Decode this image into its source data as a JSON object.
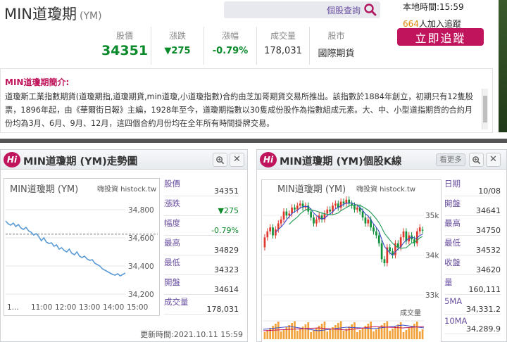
{
  "header": {
    "title": "MIN道瓊期",
    "code": "(YM)",
    "search_placeholder": "個股查詢",
    "local_time": "本地時間:15:59",
    "follow_count": "664",
    "follow_suffix": "人加入追蹤",
    "follow_button": "立即追蹤"
  },
  "quote": {
    "columns": [
      {
        "label": "股價",
        "value": "34351"
      },
      {
        "label": "漲跌",
        "value": "▼275"
      },
      {
        "label": "漲幅",
        "value": "-0.79%"
      },
      {
        "label": "成交量",
        "value": "178,031"
      },
      {
        "label": "股市",
        "value": "國際期貨"
      }
    ]
  },
  "intro": {
    "heading": "MIN道瓊期簡介:",
    "text": "道瓊斯工業指數期貨(道瓊期指,道瓊期貨,min道瓊,小道瓊指數)合約由芝加哥期貨交易所推出。該指數於1884年創立，初期只有12隻股票，1896年起，由《華爾街日報》主編，1928年至今，道瓊期指數以30隻成份股作為指數組成元素。大、中、小型道指期貨的合約月份均為3月、6月、9月、12月，這四個合約月份均在全年所有時間掛牌交易。"
  },
  "trend_panel": {
    "title": "MIN道瓊期 (YM)走勢圖",
    "chart_title": "MIN道瓊期 (YM)",
    "brand": "嗨投資 histock.tw",
    "stats": [
      {
        "label": "股價",
        "value": "34351"
      },
      {
        "label": "漲跌",
        "value": "▼275"
      },
      {
        "label": "幅度",
        "value": "-0.79%"
      },
      {
        "label": "最高",
        "value": "34829"
      },
      {
        "label": "最低",
        "value": "34323"
      },
      {
        "label": "開盤",
        "value": "34614"
      },
      {
        "label": "成交量",
        "value": "178,031"
      }
    ],
    "update_time": "更新時間:2021.10.11 15:59"
  },
  "kline_panel": {
    "title": "MIN道瓊期 (YM)個股K線",
    "more_button": "看更多",
    "chart_title": "MIN道瓊期 (YM)",
    "brand": "嗨投資 histock.tw",
    "volume_label": "成交量",
    "stats": [
      {
        "label": "日期",
        "value": "10/08"
      },
      {
        "label": "開盤",
        "value": "34641"
      },
      {
        "label": "最高",
        "value": "34750"
      },
      {
        "label": "最低",
        "value": "34532"
      },
      {
        "label": "收盤",
        "value": "34620"
      },
      {
        "label": "量",
        "value": "160,111"
      },
      {
        "label": "5MA",
        "value": "34,331.2"
      },
      {
        "label": "10MA",
        "value": "34,289.9"
      }
    ]
  },
  "chart_data": [
    {
      "type": "line",
      "title": "MIN道瓊期 (YM)",
      "x_ticks": [
        "1...",
        "11:00",
        "12:00",
        "13:00",
        "14:00",
        "15:00"
      ],
      "y_ticks": [
        34800,
        34600,
        34400,
        34200
      ],
      "ylim": [
        34150,
        34900
      ],
      "reference_value": 34626,
      "series": [
        {
          "values": [
            34720,
            34700,
            34690,
            34705,
            34680,
            34695,
            34670,
            34660,
            34675,
            34650,
            34640,
            34620,
            34630,
            34610,
            34580,
            34600,
            34570,
            34560,
            34565,
            34540,
            34550,
            34520,
            34530,
            34510,
            34500,
            34520,
            34490,
            34480,
            34500,
            34470,
            34460,
            34470,
            34450,
            34440,
            34445,
            34420,
            34410,
            34400,
            34380,
            34370,
            34360,
            34350,
            34340,
            34335,
            34345,
            34330,
            34340,
            34350
          ]
        }
      ]
    },
    {
      "type": "candlestick",
      "title": "MIN道瓊期 (YM)",
      "y_ticks": [
        "35k",
        "34k",
        "33k"
      ],
      "ylim": [
        32950,
        35500
      ],
      "series": [
        {
          "open": [
            34200,
            34450,
            34600,
            34700,
            34500,
            34650,
            34800,
            34900,
            35100,
            35000,
            35050,
            35200,
            35150,
            35250,
            35300,
            35200,
            35250,
            35100,
            34950,
            34800,
            34900,
            35000,
            34900,
            35050,
            35150,
            35100,
            35250,
            35300,
            35200,
            35350,
            35300,
            35400,
            35300,
            35250,
            35150,
            35200,
            35100,
            34950,
            34800,
            34900,
            34700,
            34600,
            34500,
            34300,
            33900,
            33800,
            34200,
            34100,
            34000,
            34300,
            34200,
            34450,
            34600,
            34350,
            34500,
            34400,
            34300,
            34600,
            34641
          ],
          "close": [
            34450,
            34600,
            34700,
            34500,
            34650,
            34800,
            34900,
            35100,
            35000,
            35050,
            35200,
            35150,
            35250,
            35300,
            35200,
            35250,
            35100,
            34950,
            34800,
            34900,
            35000,
            34900,
            35050,
            35150,
            35100,
            35250,
            35300,
            35200,
            35350,
            35300,
            35400,
            35300,
            35250,
            35150,
            35200,
            35100,
            34950,
            34800,
            34900,
            34700,
            34600,
            34500,
            34300,
            33900,
            33800,
            34200,
            34100,
            34000,
            34300,
            34200,
            34450,
            34600,
            34350,
            34500,
            34400,
            34300,
            34600,
            34700,
            34620
          ]
        }
      ]
    }
  ]
}
